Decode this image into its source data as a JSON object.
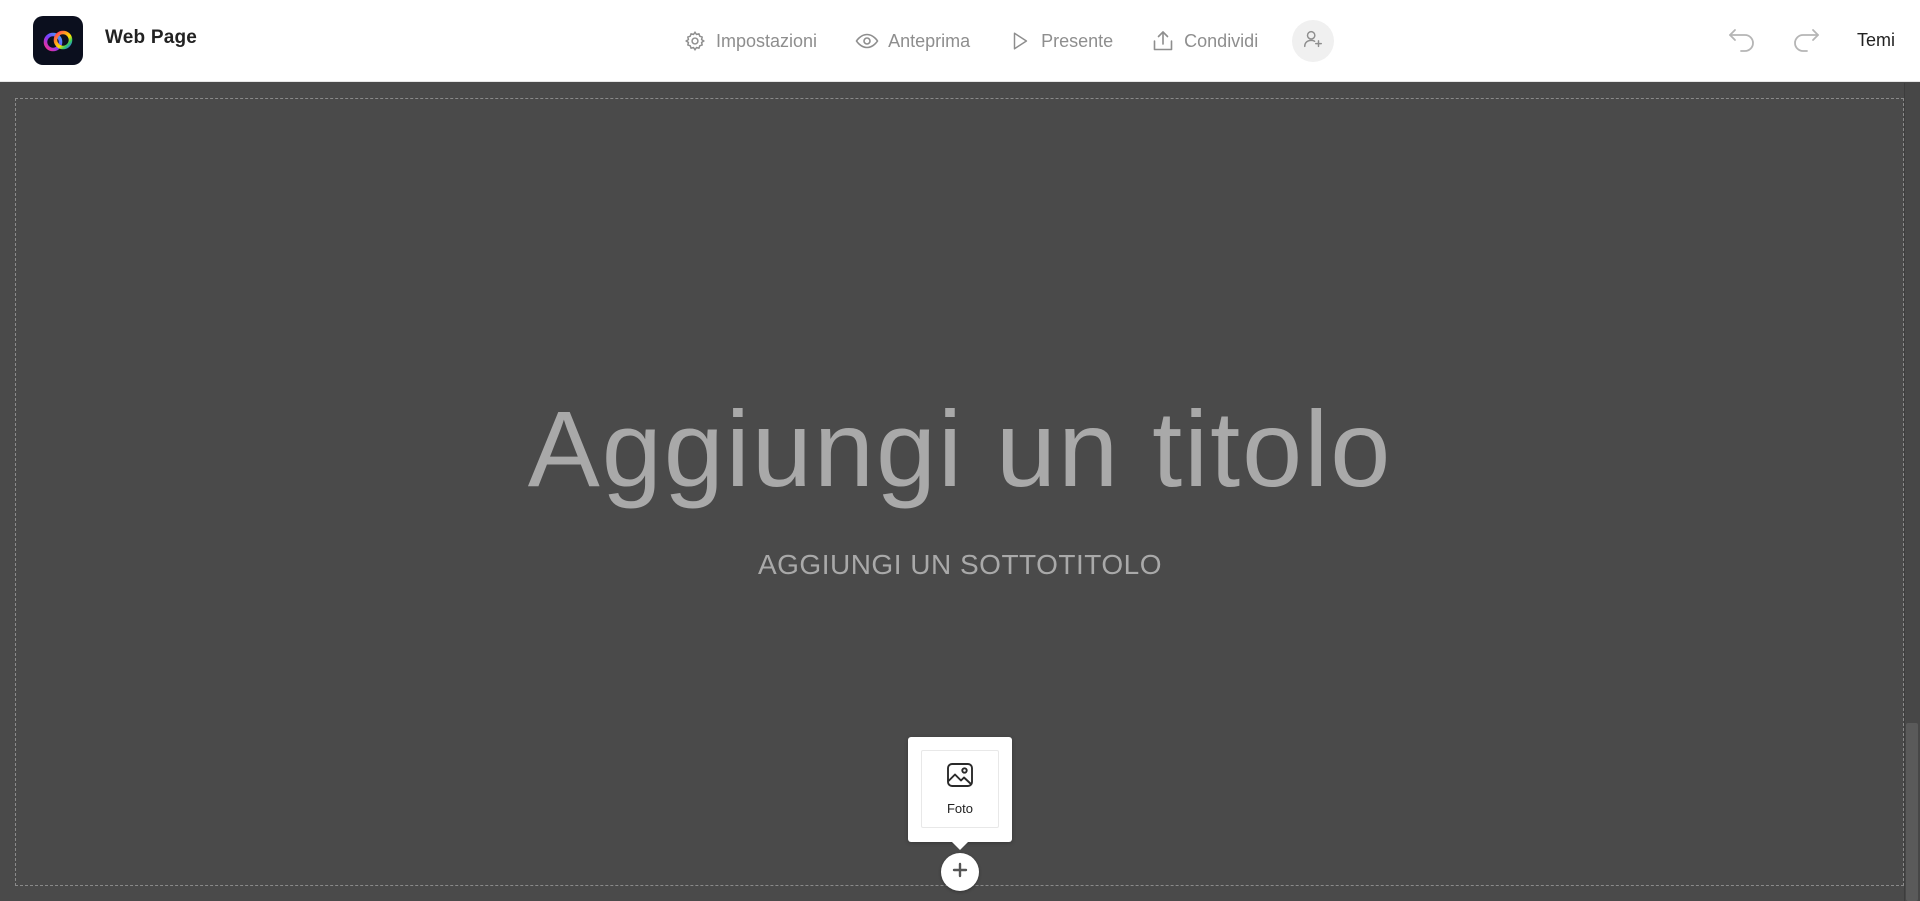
{
  "header": {
    "doc_title": "Web Page",
    "logo_icon": "creative-cloud-logo-icon",
    "nav": [
      {
        "label": "Impostazioni",
        "icon": "gear-icon"
      },
      {
        "label": "Anteprima",
        "icon": "eye-icon"
      },
      {
        "label": "Presente",
        "icon": "play-icon"
      },
      {
        "label": "Condividi",
        "icon": "share-icon"
      }
    ],
    "invite_icon": "add-person-icon",
    "undo_icon": "undo-icon",
    "redo_icon": "redo-icon",
    "themes_label": "Temi"
  },
  "canvas": {
    "title": "Aggiungi un titolo",
    "subtitle": "AGGIUNGI UN SOTTOTITOLO",
    "background": "#4a4a4a"
  },
  "add_menu": {
    "items": [
      {
        "label": "Foto",
        "icon": "image-icon"
      }
    ],
    "add_icon": "plus-icon"
  },
  "colors": {
    "topbar": "#ffffff",
    "nav_text": "#8e8e8e",
    "canvas": "#4a4a4a",
    "placeholder_text": "#a9a9a9"
  }
}
